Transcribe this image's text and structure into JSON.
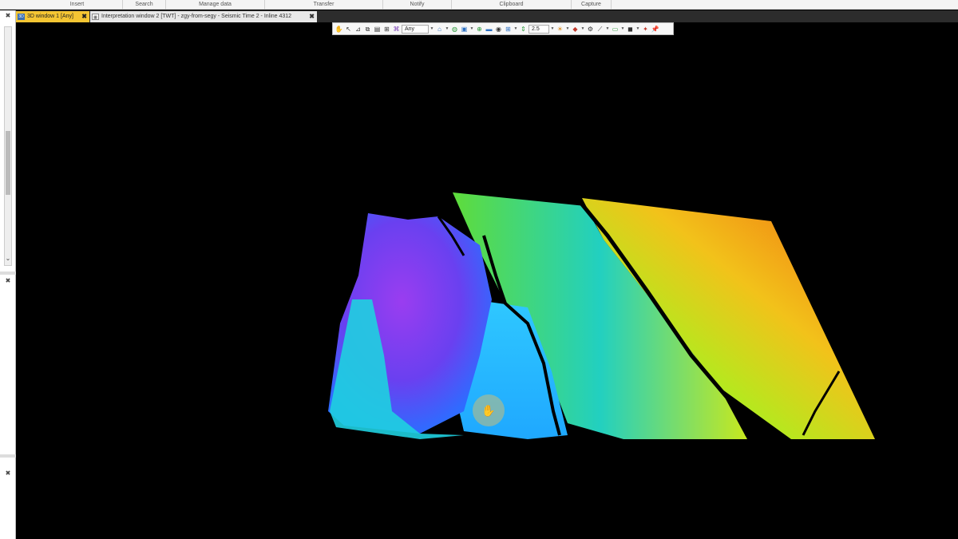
{
  "ribbon": {
    "groups": [
      {
        "label": "Insert"
      },
      {
        "label": "Search"
      },
      {
        "label": "Manage data"
      },
      {
        "label": "Transfer"
      },
      {
        "label": "Notify"
      },
      {
        "label": "Clipboard"
      },
      {
        "label": "Capture"
      }
    ]
  },
  "tabs": [
    {
      "label": "3D window 1 [Any]",
      "icon_text": "3D",
      "active": true,
      "close": "✖"
    },
    {
      "label": "Interpretation window 2 [TWT] - zgy-from-segy - Seismic Time 2 - Inline 4312",
      "icon": "window-icon",
      "active": false,
      "close": "✖"
    }
  ],
  "toolbar": {
    "domain_select": "Any",
    "zoom_value": "2.5"
  },
  "viewport": {
    "content": "seismic-horizon-surface",
    "colormap": [
      "#8a2be2",
      "#2f6bff",
      "#1fd0e0",
      "#3ad44a",
      "#c8e81e",
      "#f2c21a",
      "#f06a10"
    ],
    "cursor": "pan-hand-icon"
  }
}
